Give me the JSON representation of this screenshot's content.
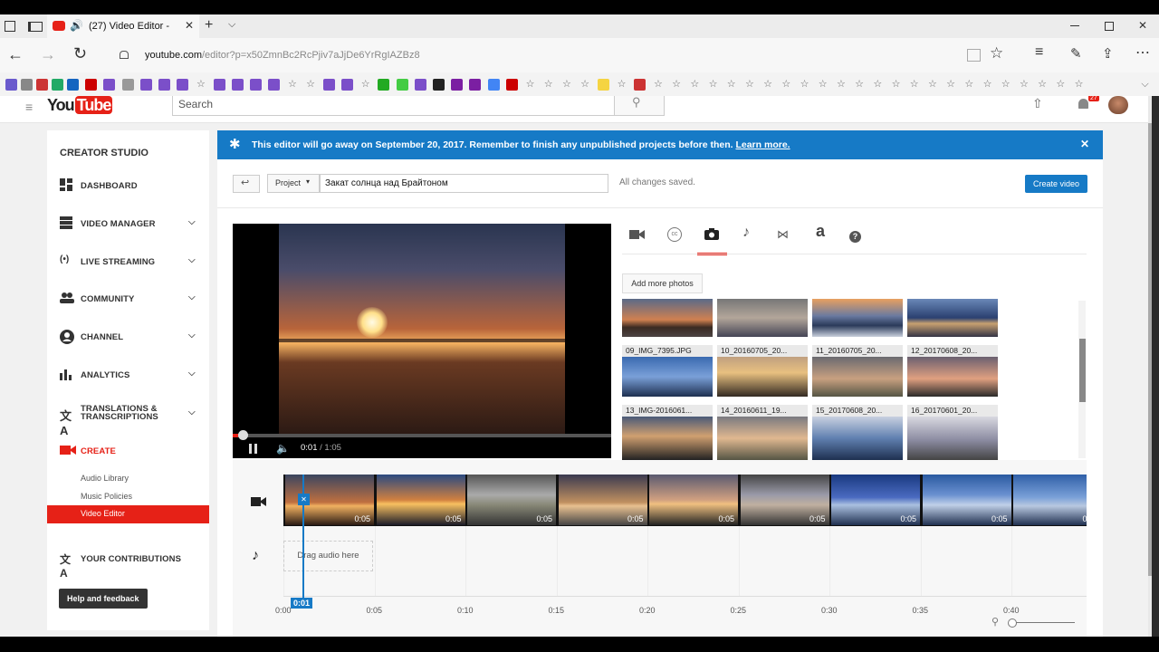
{
  "browser": {
    "tab_title": "(27) Video Editor - ",
    "url_host": "youtube.com",
    "url_path": "/editor?p=x50ZmnBc2RcPjiv7aJjDe6YrRgIAZBz8",
    "new_tab_symbol": "+"
  },
  "header": {
    "logo_you": "You",
    "logo_tube": "Tube",
    "search_placeholder": "Search",
    "notification_count": "27"
  },
  "sidebar": {
    "studio_title": "CREATOR STUDIO",
    "items": [
      {
        "label": "DASHBOARD"
      },
      {
        "label": "VIDEO MANAGER"
      },
      {
        "label": "LIVE STREAMING"
      },
      {
        "label": "COMMUNITY"
      },
      {
        "label": "CHANNEL"
      },
      {
        "label": "ANALYTICS"
      },
      {
        "label": "TRANSLATIONS &"
      },
      {
        "label": "TRANSCRIPTIONS"
      },
      {
        "label": "CREATE"
      }
    ],
    "sub_items": [
      {
        "label": "Audio Library"
      },
      {
        "label": "Music Policies"
      },
      {
        "label": "Video Editor"
      }
    ],
    "contributions": "YOUR CONTRIBUTIONS",
    "help": "Help and feedback"
  },
  "banner": {
    "message": "This editor will go away on September 20, 2017. Remember to finish any unpublished projects before then.",
    "link": "Learn more."
  },
  "toolbar": {
    "project_label": "Project",
    "project_name": "Закат солнца над Брайтоном",
    "status": "All changes saved.",
    "create_button": "Create video"
  },
  "player": {
    "time_current": "0:01",
    "time_total": "/ 1:05",
    "progress": 0.015
  },
  "photos": {
    "add_button": "Add more photos",
    "captions_row2": [
      "09_IMG_7395.JPG",
      "10_20160705_20...",
      "11_20160705_20...",
      "12_20170608_20..."
    ],
    "captions_row3": [
      "13_IMG-2016061...",
      "14_20160611_19...",
      "15_20170608_20...",
      "16_20170601_20..."
    ]
  },
  "timeline": {
    "clip_duration": "0:05",
    "audio_drop": "Drag audio here",
    "ticks": [
      "0:00",
      "0:05",
      "0:10",
      "0:15",
      "0:20",
      "0:25",
      "0:30",
      "0:35",
      "0:40"
    ],
    "playhead": "0:01"
  },
  "colors": {
    "brand_red": "#e62117",
    "banner_blue": "#167ac6",
    "button_blue": "#167ac6"
  }
}
